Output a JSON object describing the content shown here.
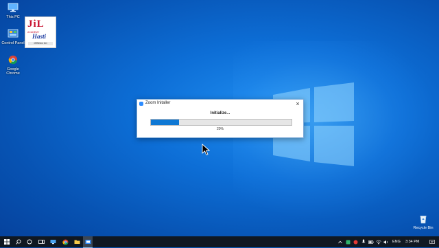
{
  "desktop": {
    "icons": [
      {
        "label": "This PC",
        "icon": "this-pc-icon"
      },
      {
        "label": "Control Panel",
        "icon": "control-panel-icon"
      },
      {
        "label": "Google Chrome",
        "icon": "chrome-icon"
      },
      {
        "label": "Recycle Bin",
        "icon": "recycle-bin-icon"
      }
    ],
    "logo": {
      "main": "JiL",
      "line1": "ACADEMY",
      "line2": "Hasti",
      "line3": "नोटिफिकेशन सेंटर"
    }
  },
  "dialog": {
    "title": "Zoom Initaller",
    "status": "Initialize...",
    "progress_fraction": 0.2,
    "percent_text": "20%",
    "close_symbol": "×"
  },
  "taskbar": {
    "language": "ENG",
    "time": "3:34 PM",
    "accent": "#0f78d4"
  }
}
